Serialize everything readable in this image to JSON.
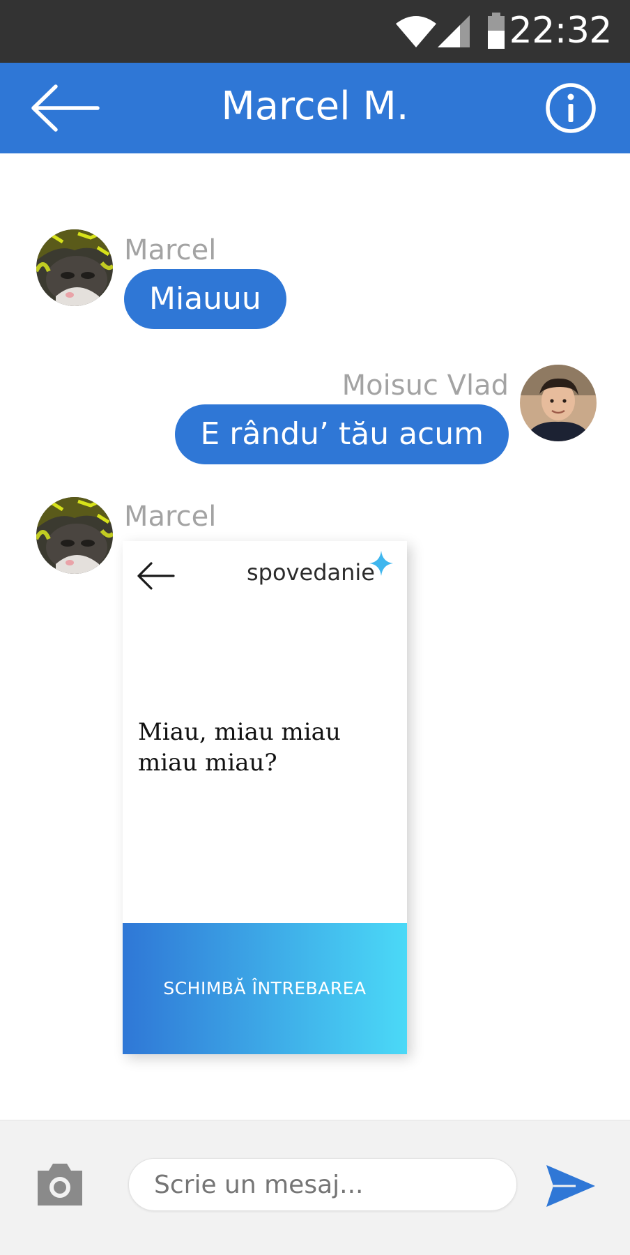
{
  "status_bar": {
    "time": "22:32",
    "icons": [
      "wifi-icon",
      "signal-icon",
      "battery-icon"
    ]
  },
  "app_bar": {
    "title": "Marcel M.",
    "back_icon": "arrow-left-icon",
    "info_icon": "info-circle-icon"
  },
  "messages": [
    {
      "sender": "Marcel",
      "text": "Miauuu",
      "side": "left",
      "avatar": "cat-avatar"
    },
    {
      "sender": "Moisuc Vlad",
      "text": "E rându’ tău acum",
      "side": "right",
      "avatar": "user-avatar"
    },
    {
      "sender": "Marcel",
      "side": "left",
      "avatar": "cat-avatar",
      "card": {
        "brand": "spovedanie",
        "question": "Miau, miau miau miau miau?",
        "button": "SCHIMBĂ ÎNTREBAREA"
      }
    }
  ],
  "composer": {
    "placeholder": "Scrie un mesaj...",
    "camera_icon": "camera-icon",
    "send_icon": "send-icon"
  },
  "colors": {
    "primary": "#2F77D6",
    "status_bar": "#333333",
    "sender_text": "#A3A3A3",
    "gradient_end": "#4BD9F7"
  }
}
